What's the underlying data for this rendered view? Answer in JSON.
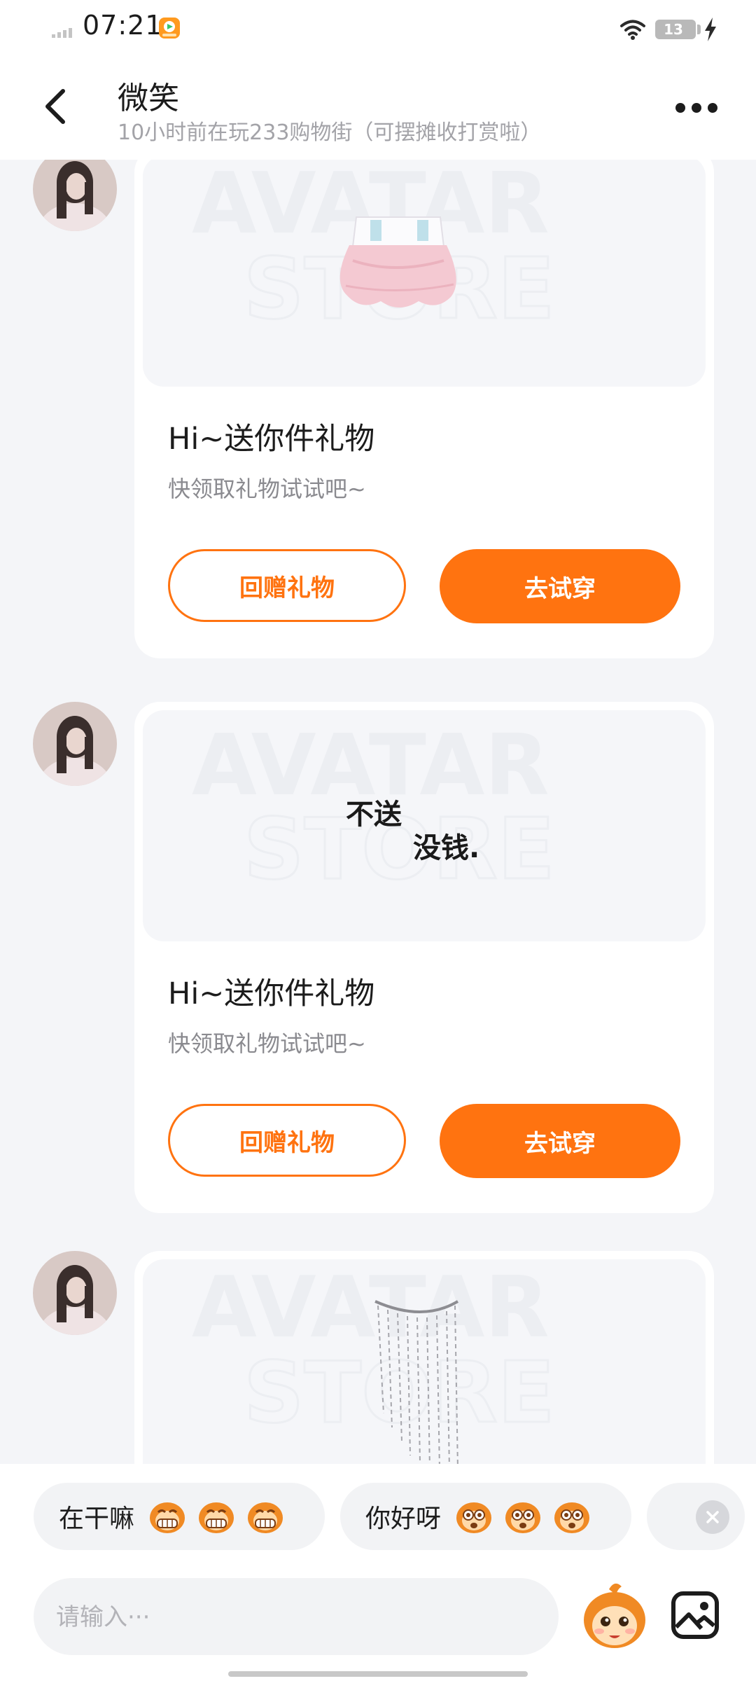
{
  "status_bar": {
    "time": "07:21",
    "battery": "13",
    "icons": [
      "signal-icon",
      "app-notification-icon",
      "wifi-icon",
      "battery-icon",
      "charging-icon"
    ]
  },
  "header": {
    "name": "微笑",
    "status": "10小时前在玩233购物街（可摆摊收打赏啦）",
    "icons": [
      "back-arrow-icon",
      "more-icon"
    ]
  },
  "messages": [
    {
      "image": "pink-skirt-gift-image",
      "watermark": [
        "AVATAR",
        "STORE"
      ],
      "title": "Hi~送你件礼物",
      "subtitle": "快领取礼物试试吧~",
      "return_gift_label": "回赠礼物",
      "try_on_label": "去试穿"
    },
    {
      "image": "text-sticker-gift-image",
      "sticker_lines": [
        "不送",
        "没钱."
      ],
      "watermark": [
        "AVATAR",
        "STORE"
      ],
      "title": "Hi~送你件礼物",
      "subtitle": "快领取礼物试试吧~",
      "return_gift_label": "回赠礼物",
      "try_on_label": "去试穿"
    },
    {
      "image": "bead-curtain-gift-image",
      "watermark": [
        "AVATAR",
        "STORE"
      ]
    }
  ],
  "quick_replies": [
    {
      "text": "在干嘛",
      "emoji": "grinning-monkey-emoji"
    },
    {
      "text": "你好呀",
      "emoji": "surprised-monkey-emoji"
    }
  ],
  "composer": {
    "placeholder": "请输入···",
    "icons": [
      "close-icon",
      "mascot-emoji-icon",
      "image-icon"
    ]
  },
  "colors": {
    "accent": "#ff7310",
    "background": "#f4f5f8",
    "card": "#ffffff",
    "chip": "#f2f3f5"
  }
}
